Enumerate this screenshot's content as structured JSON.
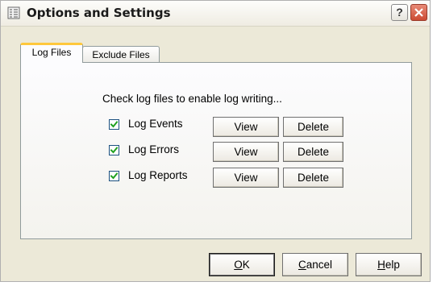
{
  "window": {
    "title": "Options and Settings",
    "help_caption": "?"
  },
  "tabs": [
    {
      "label": "Log Files",
      "active": true
    },
    {
      "label": "Exclude Files",
      "active": false
    }
  ],
  "panel": {
    "instruction": "Check log files to enable log writing...",
    "rows": [
      {
        "label": "Log Events",
        "checked": true,
        "view": "View",
        "delete": "Delete"
      },
      {
        "label": "Log Errors",
        "checked": true,
        "view": "View",
        "delete": "Delete"
      },
      {
        "label": "Log Reports",
        "checked": true,
        "view": "View",
        "delete": "Delete"
      }
    ]
  },
  "footer": {
    "ok": {
      "mnemonic": "O",
      "rest": "K"
    },
    "cancel": {
      "mnemonic": "C",
      "rest": "ancel"
    },
    "help": {
      "mnemonic": "H",
      "rest": "elp"
    }
  },
  "colors": {
    "dialog_bg": "#ece9d8",
    "tab_accent": "#ffc83c",
    "close_button": "#cc4b33"
  }
}
